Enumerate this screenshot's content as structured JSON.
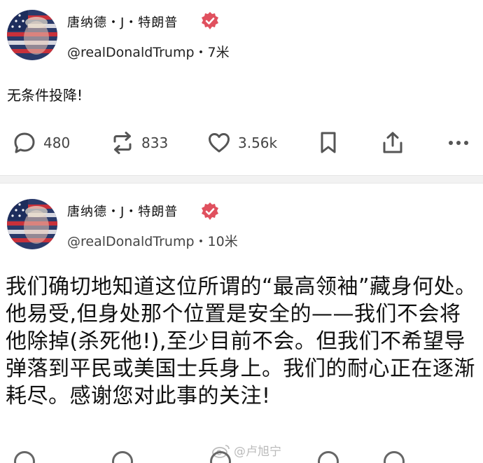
{
  "posts": [
    {
      "display_name": "唐纳德・J・特朗普",
      "handle": "@realDonaldTrump",
      "separator": "・",
      "time": "7米",
      "text": "无条件投降!",
      "reply_count": "480",
      "repost_count": "833",
      "like_count": "3.56k"
    },
    {
      "display_name": "唐纳德・J・特朗普",
      "handle": "@realDonaldTrump",
      "separator": "・",
      "time": "10米",
      "text": "我们确切地知道这位所谓的“最高领袖”藏身何处。他易受,但身处那个位置是安全的——我们不会将他除掉(杀死他!),至少目前不会。但我们不希望导弹落到平民或美国士兵身上。我们的耐心正在逐渐耗尽。感谢您对此事的关注!"
    }
  ],
  "watermark": "@卢旭宁",
  "icons": {
    "avatar": "flag-portrait-avatar",
    "verified": "verified-badge-icon",
    "reply": "speech-bubble-icon",
    "repost": "repost-arrows-icon",
    "like": "heart-icon",
    "bookmark": "bookmark-icon",
    "share": "share-upload-icon",
    "more": "more-dots-icon",
    "watermark": "weibo-logo-icon"
  },
  "colors": {
    "verified_badge": "#e0505e",
    "icon_gray": "#555555",
    "count_gray": "#444444",
    "separator_bg": "#f2f2f2"
  }
}
